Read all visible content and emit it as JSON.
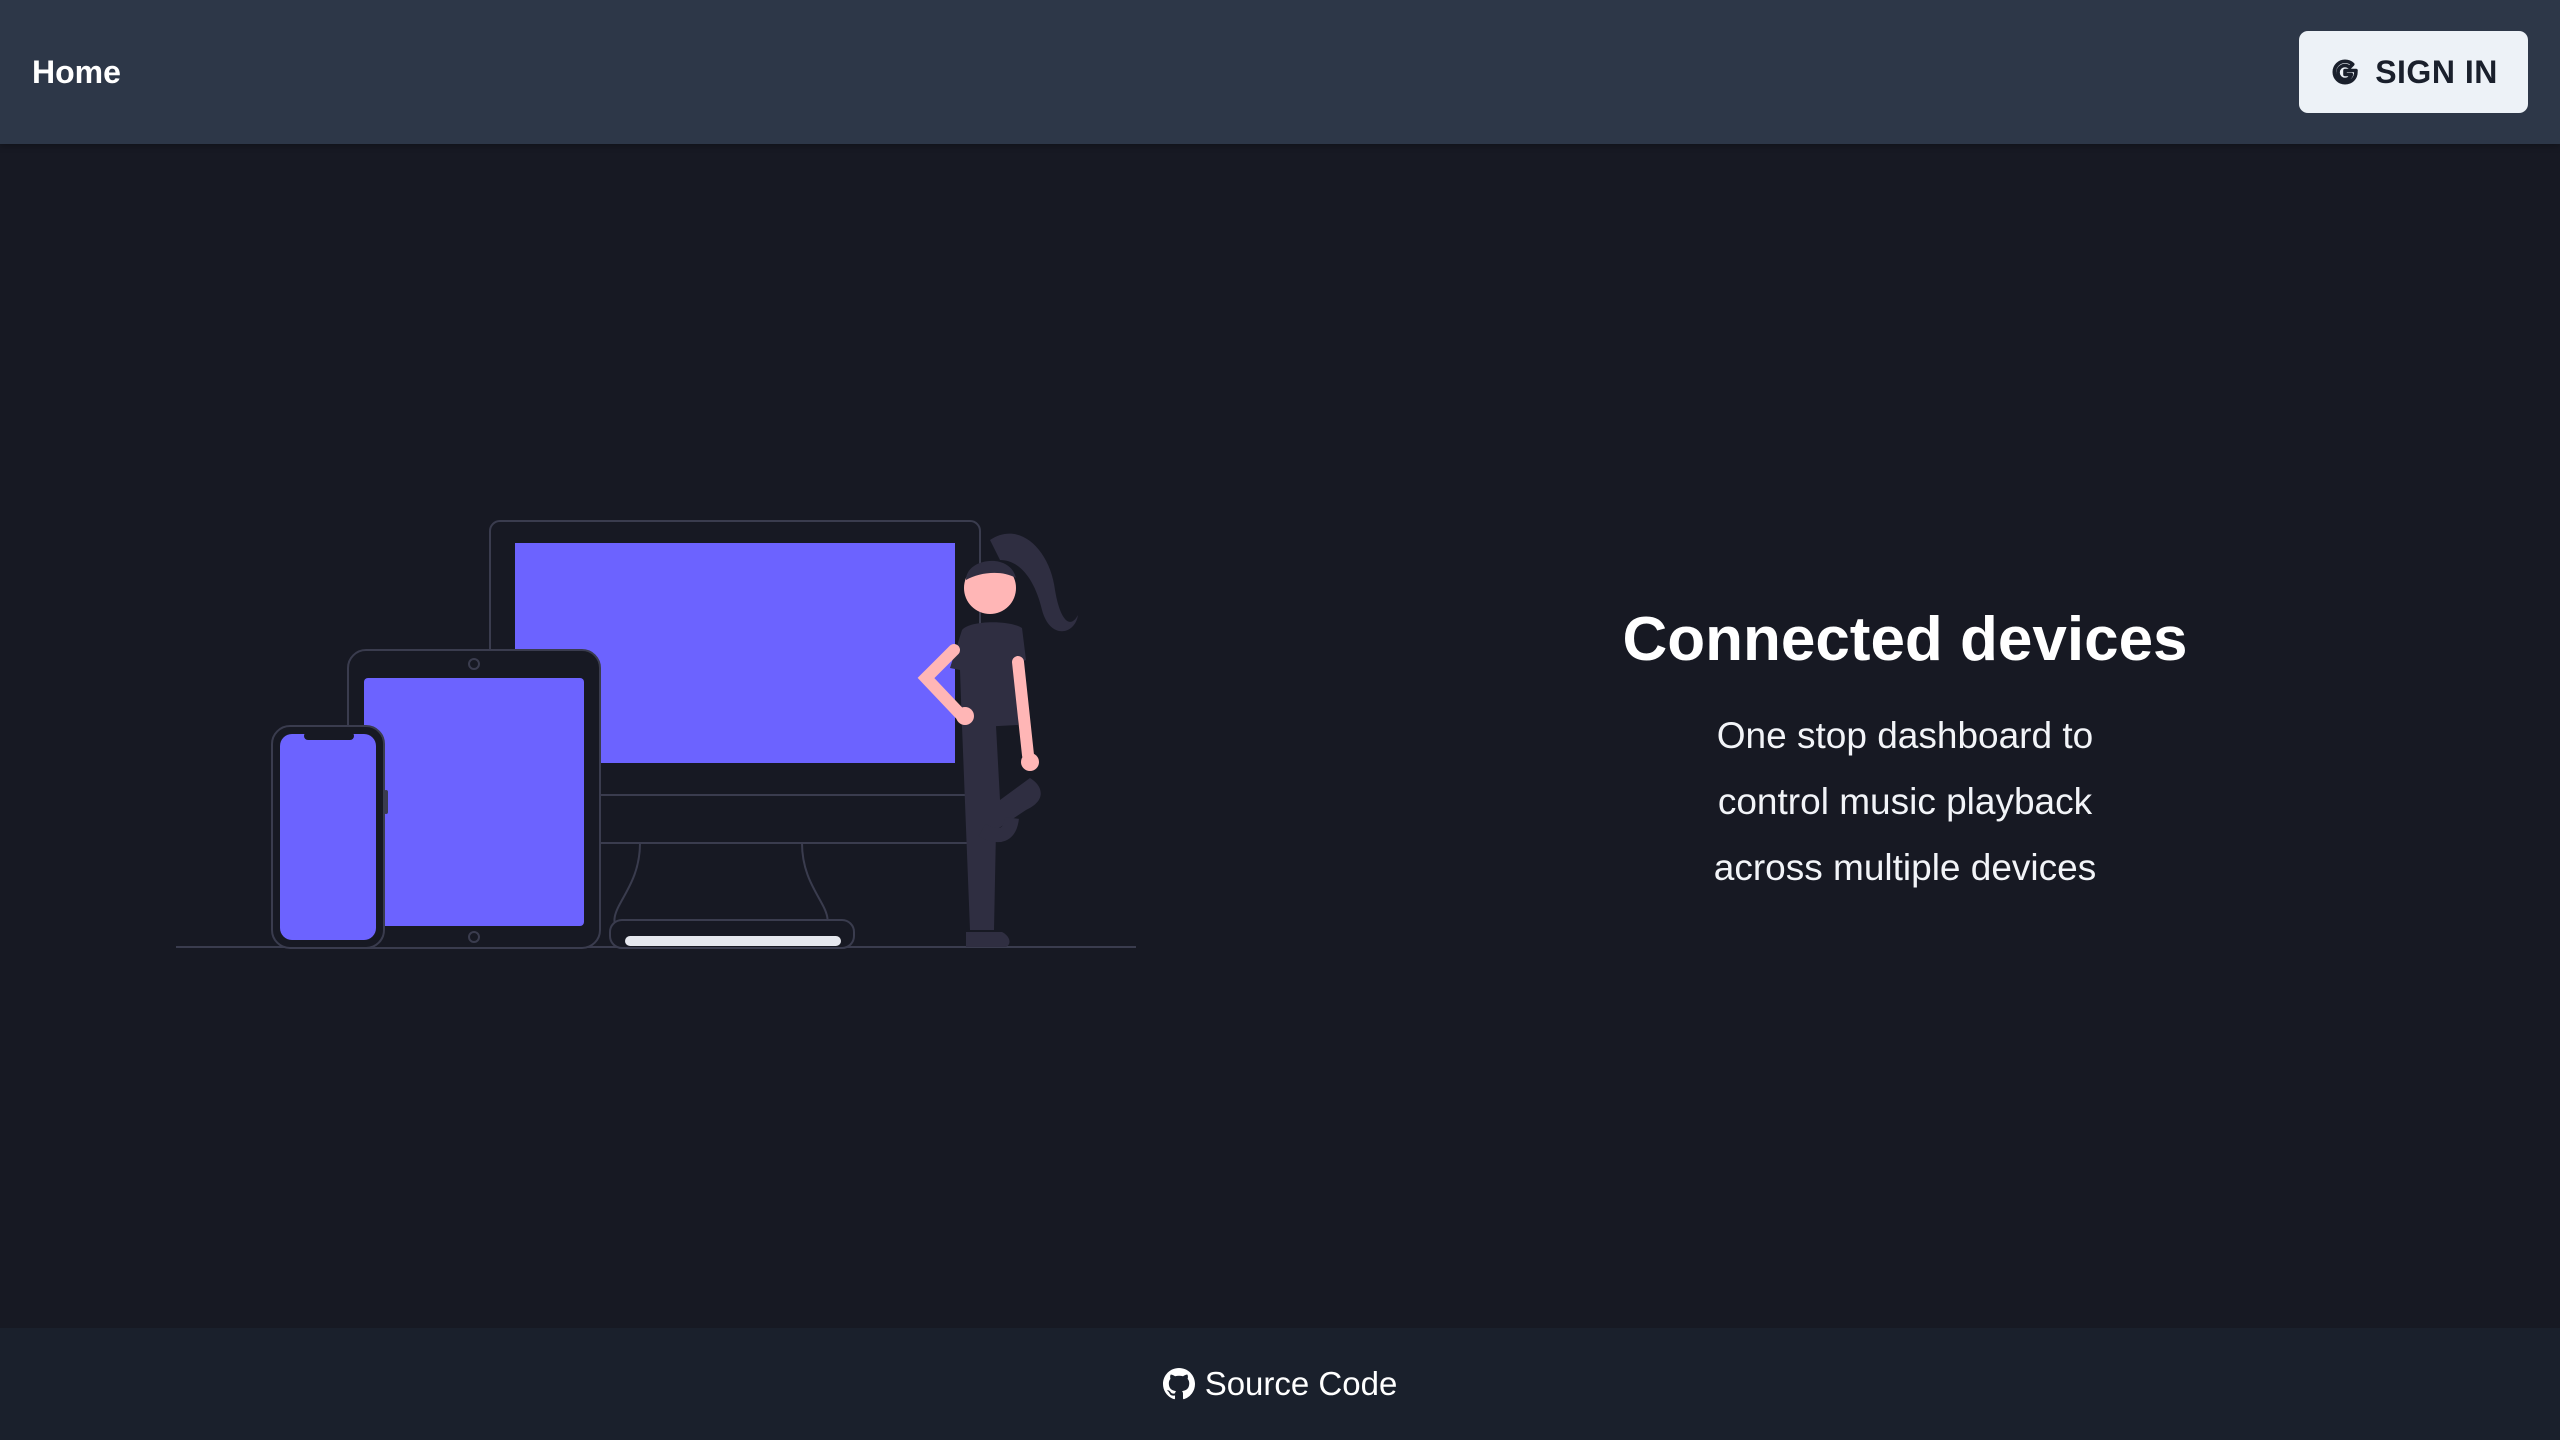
{
  "header": {
    "home_label": "Home",
    "signin_label": "SIGN IN",
    "signin_icon": "google-icon"
  },
  "hero": {
    "title": "Connected devices",
    "description_lines": [
      "One stop dashboard to",
      "control music playback",
      "across multiple devices"
    ],
    "illustration": "devices-with-person-illustration"
  },
  "footer": {
    "source_label": "Source Code",
    "source_icon": "github-icon"
  },
  "colors": {
    "header_bg": "#2d3748",
    "page_bg": "#171923",
    "footer_bg": "#1a202c",
    "accent": "#6c63ff",
    "button_bg": "#edf2f7"
  }
}
